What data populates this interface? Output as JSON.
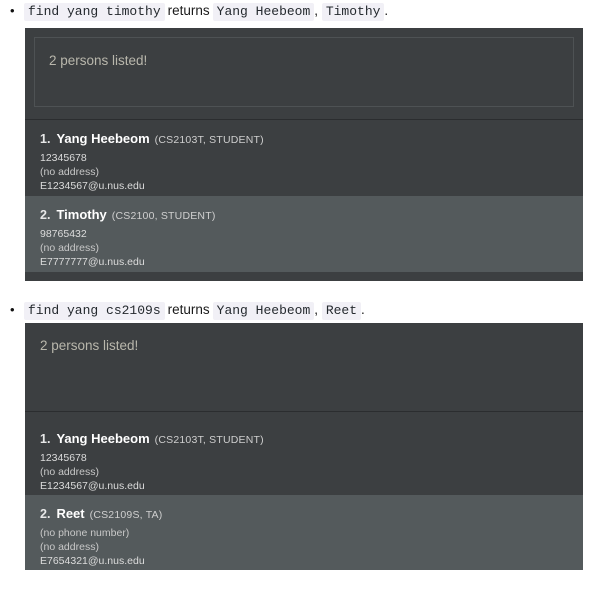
{
  "entries": [
    {
      "bullet": {
        "command": "find yang timothy",
        "middle": "returns",
        "result_a": "Yang Heebeom",
        "comma": ",",
        "result_b": "Timothy",
        "period": "."
      },
      "card": {
        "status_text": "2 persons listed!",
        "persons": [
          {
            "index": "1.",
            "name": "Yang Heebeom",
            "tags": "(CS2103T, STUDENT)",
            "phone": "12345678",
            "address": "(no address)",
            "email": "E1234567@u.nus.edu"
          },
          {
            "index": "2.",
            "name": "Timothy",
            "tags": "(CS2100, STUDENT)",
            "phone": "98765432",
            "address": "(no address)",
            "email": "E7777777@u.nus.edu"
          }
        ]
      }
    },
    {
      "bullet": {
        "command": "find yang cs2109s",
        "middle": "returns",
        "result_a": "Yang Heebeom",
        "comma": ",",
        "result_b": "Reet",
        "period": "."
      },
      "card": {
        "status_text": "2 persons listed!",
        "persons": [
          {
            "index": "1.",
            "name": "Yang Heebeom",
            "tags": "(CS2103T, STUDENT)",
            "phone": "12345678",
            "address": "(no address)",
            "email": "E1234567@u.nus.edu"
          },
          {
            "index": "2.",
            "name": "Reet",
            "tags": "(CS2109S, TA)",
            "phone": "(no phone number)",
            "address": "(no address)",
            "email": "E7654321@u.nus.edu"
          }
        ]
      }
    }
  ],
  "colors": {
    "card_bg": "#3c3f41",
    "row_alt_bg": "#545a5c",
    "status_text": "#b9b7ac",
    "code_bg": "#f1f0f6"
  }
}
